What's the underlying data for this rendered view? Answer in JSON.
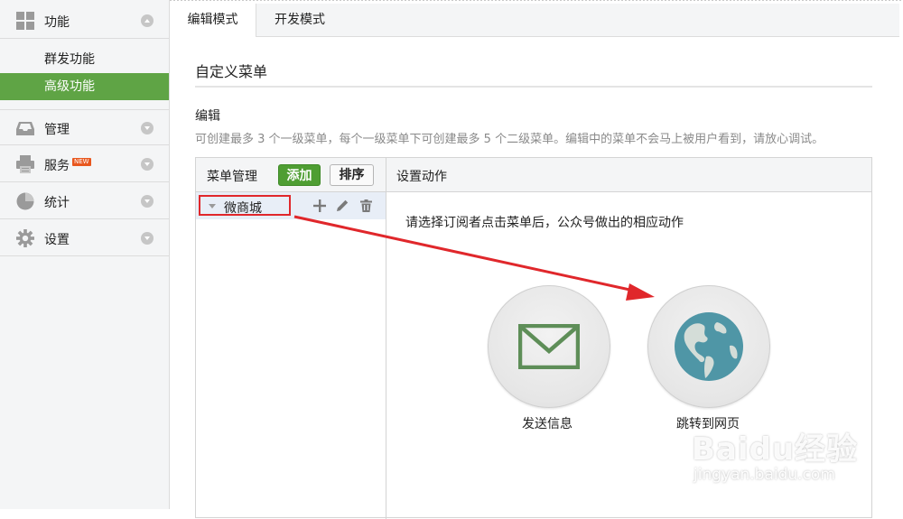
{
  "sidebar": {
    "groups": [
      {
        "label": "功能",
        "icon": "grid-icon"
      },
      {
        "label": "管理",
        "icon": "inbox-icon"
      },
      {
        "label": "服务",
        "icon": "printer-icon",
        "badge": "NEW"
      },
      {
        "label": "统计",
        "icon": "pie-chart-icon"
      },
      {
        "label": "设置",
        "icon": "gear-icon"
      }
    ],
    "sub_items": [
      {
        "label": "群发功能",
        "active": false
      },
      {
        "label": "高级功能",
        "active": true
      }
    ]
  },
  "tabs": [
    {
      "label": "编辑模式",
      "active": true
    },
    {
      "label": "开发模式",
      "active": false
    }
  ],
  "section_title": "自定义菜单",
  "edit": {
    "heading": "编辑",
    "description": "可创建最多 3 个一级菜单，每个一级菜单下可创建最多 5 个二级菜单。编辑中的菜单不会马上被用户看到，请放心调试。"
  },
  "menu_panel": {
    "title": "菜单管理",
    "add_button": "添加",
    "sort_button": "排序",
    "items": [
      {
        "label": "微商城"
      }
    ]
  },
  "action_panel": {
    "title": "设置动作",
    "prompt": "请选择订阅者点击菜单后，公众号做出的相应动作",
    "options": [
      {
        "label": "发送信息",
        "icon": "envelope-icon"
      },
      {
        "label": "跳转到网页",
        "icon": "globe-icon"
      }
    ]
  },
  "watermark": {
    "logo": "Baidu经验",
    "url": "jingyan.baidu.com"
  },
  "colors": {
    "accent_green": "#5fa445",
    "annotation_red": "#e0272b",
    "globe_blue": "#4f96a6",
    "envelope_green": "#5e8e58"
  }
}
